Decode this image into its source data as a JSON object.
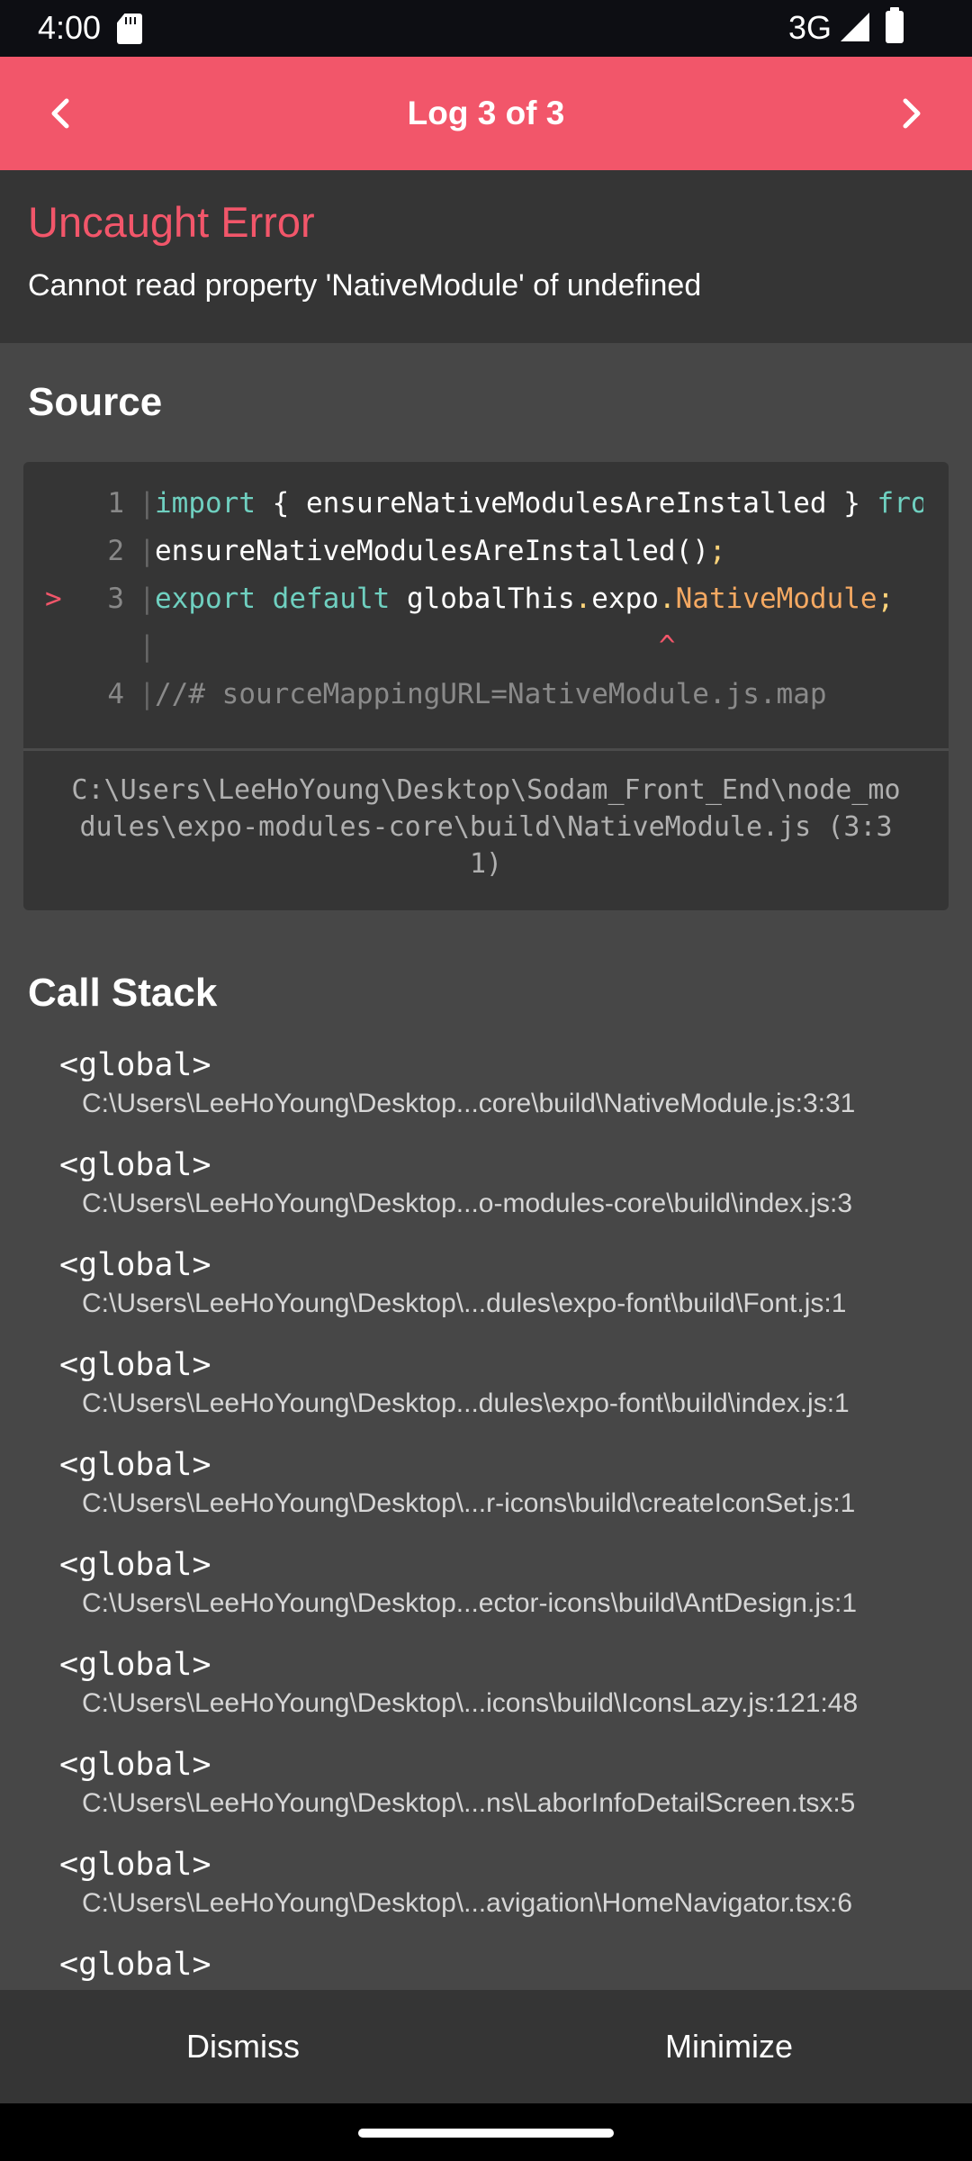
{
  "status_bar": {
    "time": "4:00",
    "network": "3G",
    "icons": [
      "sd-card-icon",
      "signal-icon",
      "battery-icon"
    ]
  },
  "header": {
    "title": "Log 3 of 3",
    "prev_icon": "chevron-left-icon",
    "next_icon": "chevron-right-icon"
  },
  "error": {
    "title": "Uncaught Error",
    "message": "Cannot read property 'NativeModule' of undefined"
  },
  "source": {
    "title": "Source",
    "lines": [
      {
        "marker": "",
        "num": "1",
        "bar": "|",
        "tokens": [
          {
            "t": "import",
            "c": "kw"
          },
          {
            "t": " { ensureNativeModulesAreInstalled } ",
            "c": ""
          },
          {
            "t": "from",
            "c": "kw"
          }
        ]
      },
      {
        "marker": "",
        "num": "2",
        "bar": "|",
        "tokens": [
          {
            "t": "ensureNativeModulesAreInstalled()",
            "c": ""
          },
          {
            "t": ";",
            "c": "punc"
          }
        ]
      },
      {
        "marker": ">",
        "num": "3",
        "bar": "|",
        "tokens": [
          {
            "t": "export",
            "c": "kw"
          },
          {
            "t": " ",
            "c": ""
          },
          {
            "t": "default",
            "c": "kw"
          },
          {
            "t": " globalThis",
            "c": ""
          },
          {
            "t": ".",
            "c": "punc"
          },
          {
            "t": "expo",
            "c": ""
          },
          {
            "t": ".",
            "c": "punc"
          },
          {
            "t": "NativeModule",
            "c": "prop"
          },
          {
            "t": ";",
            "c": "punc"
          }
        ]
      },
      {
        "marker": "",
        "num": "",
        "bar": "|",
        "tokens": [
          {
            "t": "                              ^",
            "c": "caret"
          }
        ]
      },
      {
        "marker": "",
        "num": "4",
        "bar": "|",
        "tokens": [
          {
            "t": "//# sourceMappingURL=NativeModule.js.map",
            "c": "cmt"
          }
        ]
      }
    ],
    "file_path": "C:\\Users\\LeeHoYoung\\Desktop\\Sodam_Front_End\\node_modules\\expo-modules-core\\build\\NativeModule.js (3:31)"
  },
  "call_stack": {
    "title": "Call Stack",
    "frames": [
      {
        "name": "<global>",
        "location": "C:\\Users\\LeeHoYoung\\Desktop...core\\build\\NativeModule.js:3:31"
      },
      {
        "name": "<global>",
        "location": "C:\\Users\\LeeHoYoung\\Desktop...o-modules-core\\build\\index.js:3"
      },
      {
        "name": "<global>",
        "location": "C:\\Users\\LeeHoYoung\\Desktop\\...dules\\expo-font\\build\\Font.js:1"
      },
      {
        "name": "<global>",
        "location": "C:\\Users\\LeeHoYoung\\Desktop...dules\\expo-font\\build\\index.js:1"
      },
      {
        "name": "<global>",
        "location": "C:\\Users\\LeeHoYoung\\Desktop\\...r-icons\\build\\createIconSet.js:1"
      },
      {
        "name": "<global>",
        "location": "C:\\Users\\LeeHoYoung\\Desktop...ector-icons\\build\\AntDesign.js:1"
      },
      {
        "name": "<global>",
        "location": "C:\\Users\\LeeHoYoung\\Desktop\\...icons\\build\\IconsLazy.js:121:48"
      },
      {
        "name": "<global>",
        "location": "C:\\Users\\LeeHoYoung\\Desktop\\...ns\\LaborInfoDetailScreen.tsx:5"
      },
      {
        "name": "<global>",
        "location": "C:\\Users\\LeeHoYoung\\Desktop\\...avigation\\HomeNavigator.tsx:6"
      },
      {
        "name": "<global>",
        "location": ""
      }
    ]
  },
  "footer": {
    "dismiss_label": "Dismiss",
    "minimize_label": "Minimize"
  },
  "colors": {
    "accent": "#f2566a",
    "panel": "#353535",
    "background": "#474747"
  }
}
